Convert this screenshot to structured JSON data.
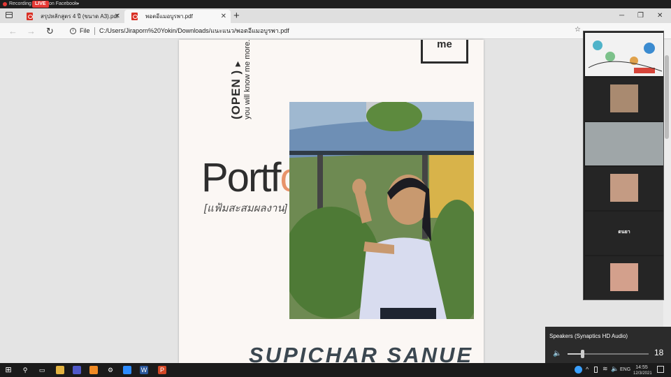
{
  "recording": {
    "rec_label": "Recording",
    "live_badge": "LIVE",
    "destination": "on Facebook"
  },
  "tabs": [
    {
      "title": "สรุปหลักสูตร 4 ปี (ขนาด A3).pdf"
    },
    {
      "title": "พอตอีแมอบูรพา.pdf"
    }
  ],
  "window": {
    "minimize": "─",
    "restore": "❐",
    "close": "✕"
  },
  "address": {
    "scheme": "File",
    "url": "C:/Users/Jiraporn%20Yokin/Downloads/แนะแนว/พอตอีแมอบูรพา.pdf"
  },
  "pdf": {
    "me_label": "me",
    "open_label": "(OPEN )",
    "open_arrow": "▶",
    "know_line": "you will know me more.",
    "title_dark": "Portf",
    "title_orange": "olio",
    "subtitle": "[แฟ้มสะสมผลงาน]",
    "name_partial": "SUPICHAR SANUE"
  },
  "meeting": {
    "participant_name": "ดนยา"
  },
  "volume": {
    "device": "Speakers (Synaptics HD Audio)",
    "level": 18
  },
  "taskbar": {
    "lang": "ENG",
    "time": "14:55",
    "date": "12/3/2021"
  },
  "colors": {
    "accent_orange": "#e8936a",
    "live_red": "#e53935",
    "pdf_red": "#d93025"
  }
}
